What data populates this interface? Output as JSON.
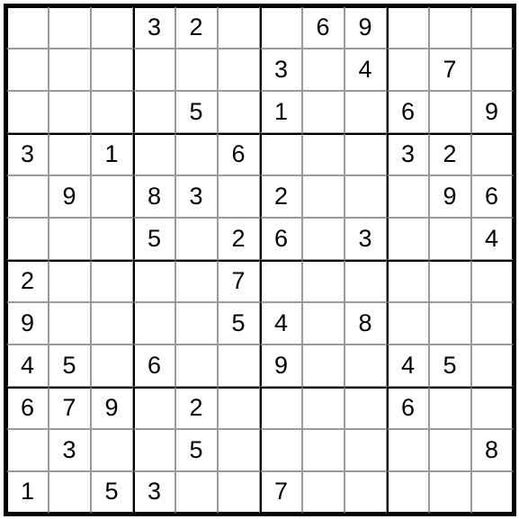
{
  "puzzle": {
    "type": "sudoku-12x12",
    "box_size": {
      "rows": 3,
      "cols": 3
    },
    "grid": [
      [
        "",
        "",
        "",
        "3",
        "2",
        "",
        "",
        "6",
        "9",
        "",
        "",
        ""
      ],
      [
        "",
        "",
        "",
        "",
        "",
        "",
        "3",
        "",
        "4",
        "",
        "7",
        ""
      ],
      [
        "",
        "",
        "",
        "",
        "5",
        "",
        "1",
        "",
        "",
        "6",
        "",
        "9"
      ],
      [
        "3",
        "",
        "1",
        "",
        "",
        "6",
        "",
        "",
        "",
        "3",
        "2",
        ""
      ],
      [
        "",
        "9",
        "",
        "8",
        "3",
        "",
        "2",
        "",
        "",
        "",
        "9",
        "6"
      ],
      [
        "",
        "",
        "",
        "5",
        "",
        "2",
        "6",
        "",
        "3",
        "",
        "",
        "4"
      ],
      [
        "2",
        "",
        "",
        "",
        "",
        "7",
        "",
        "",
        "",
        "",
        "",
        ""
      ],
      [
        "9",
        "",
        "",
        "",
        "",
        "5",
        "4",
        "",
        "8",
        "",
        "",
        ""
      ],
      [
        "4",
        "5",
        "",
        "6",
        "",
        "",
        "9",
        "",
        "",
        "4",
        "5",
        ""
      ],
      [
        "6",
        "7",
        "9",
        "",
        "2",
        "",
        "",
        "",
        "",
        "6",
        "",
        ""
      ],
      [
        "",
        "3",
        "",
        "",
        "5",
        "",
        "",
        "",
        "",
        "",
        "",
        "8"
      ],
      [
        "1",
        "",
        "5",
        "3",
        "",
        "",
        "7",
        "",
        "",
        "",
        "",
        ""
      ]
    ]
  }
}
